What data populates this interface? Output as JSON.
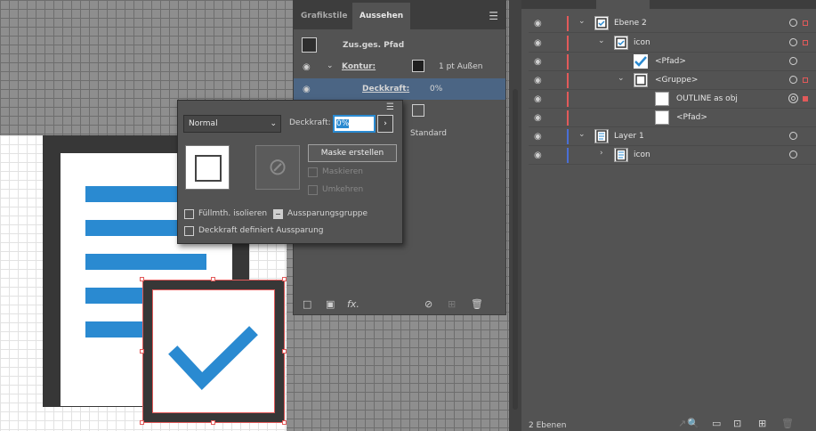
{
  "appearance_panel": {
    "tabs": [
      {
        "label": "Grafikstile"
      },
      {
        "label": "Aussehen"
      }
    ],
    "object_type": "Zus.ges. Pfad",
    "stroke": {
      "label": "Kontur:",
      "value": "1 pt  Außen"
    },
    "opacity_row": {
      "label": "Deckkraft:",
      "value": "0%"
    },
    "fill_row_value": "Standard",
    "footer_icons": [
      "new-stroke-icon",
      "new-fill-icon",
      "fx-icon",
      "clear-icon",
      "duplicate-icon",
      "delete-icon"
    ],
    "fx_label": "fx."
  },
  "transparency_popup": {
    "blend_mode": "Normal",
    "opacity_label": "Deckkraft:",
    "opacity_value": "0%",
    "mask_button": "Maske erstellen",
    "clip": "Maskieren",
    "invert": "Umkehren",
    "isolate": "Füllmth. isolieren",
    "knockout": "Aussparungsgruppe",
    "opacity_defines_knockout": "Deckkraft definiert Aussparung"
  },
  "layers_panel": {
    "rows": [
      {
        "name": "Ebene 2",
        "color": "#e25a5a"
      },
      {
        "name": "icon",
        "color": "#e25a5a"
      },
      {
        "name": "<Pfad>",
        "color": "#e25a5a"
      },
      {
        "name": "<Gruppe>",
        "color": "#e25a5a"
      },
      {
        "name": "OUTLINE as obj",
        "color": "#e25a5a"
      },
      {
        "name": "<Pfad>",
        "color": "#e25a5a"
      },
      {
        "name": "Layer 1",
        "color": "#4a6fd6"
      },
      {
        "name": "icon",
        "color": "#4a6fd6"
      }
    ],
    "status": "2 Ebenen"
  },
  "colors": {
    "accent": "#2a8ad1",
    "selection": "#e25a5a",
    "layer1": "#4a6fd6"
  }
}
